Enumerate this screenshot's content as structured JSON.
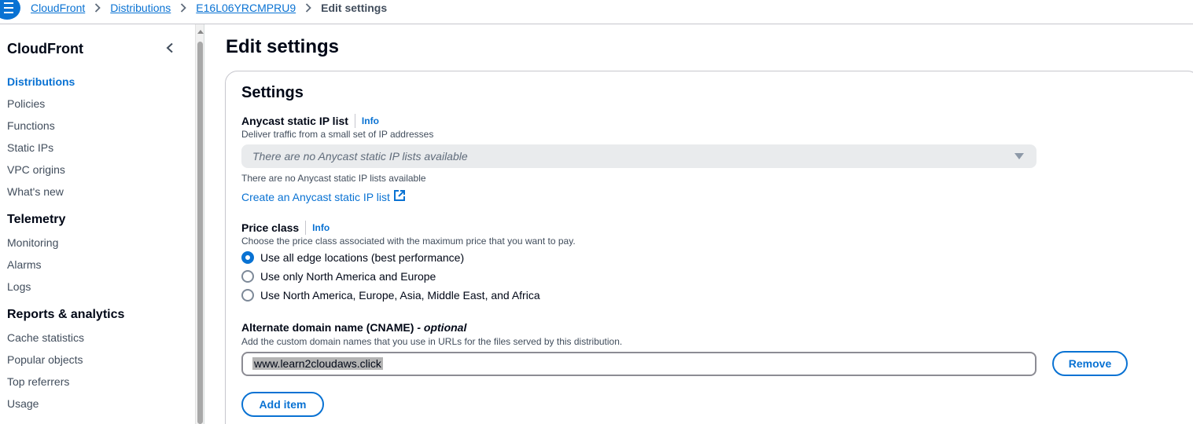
{
  "breadcrumb": {
    "items": [
      "CloudFront",
      "Distributions",
      "E16L06YRCMPRU9"
    ],
    "current": "Edit settings"
  },
  "sidebar": {
    "title": "CloudFront",
    "items_top": [
      "Distributions",
      "Policies",
      "Functions",
      "Static IPs",
      "VPC origins",
      "What's new"
    ],
    "telemetry": {
      "title": "Telemetry",
      "items": [
        "Monitoring",
        "Alarms",
        "Logs"
      ]
    },
    "reports": {
      "title": "Reports & analytics",
      "items": [
        "Cache statistics",
        "Popular objects",
        "Top referrers",
        "Usage"
      ]
    }
  },
  "page": {
    "title": "Edit settings",
    "section_title": "Settings"
  },
  "anycast": {
    "label": "Anycast static IP list",
    "info": "Info",
    "description": "Deliver traffic from a small set of IP addresses",
    "select_placeholder": "There are no Anycast static IP lists available",
    "hint": "There are no Anycast static IP lists available",
    "create_link": "Create an Anycast static IP list"
  },
  "price_class": {
    "label": "Price class",
    "info": "Info",
    "description": "Choose the price class associated with the maximum price that you want to pay.",
    "options": [
      "Use all edge locations (best performance)",
      "Use only North America and Europe",
      "Use North America, Europe, Asia, Middle East, and Africa"
    ],
    "selected_index": 0
  },
  "cname": {
    "label": "Alternate domain name (CNAME)",
    "label_optional": "- optional",
    "description": "Add the custom domain names that you use in URLs for the files served by this distribution.",
    "value": "www.learn2cloudaws.click",
    "remove_label": "Remove",
    "add_label": "Add item"
  },
  "colors": {
    "accent": "#0972d3",
    "text": "#000716",
    "muted": "#414d5c"
  }
}
